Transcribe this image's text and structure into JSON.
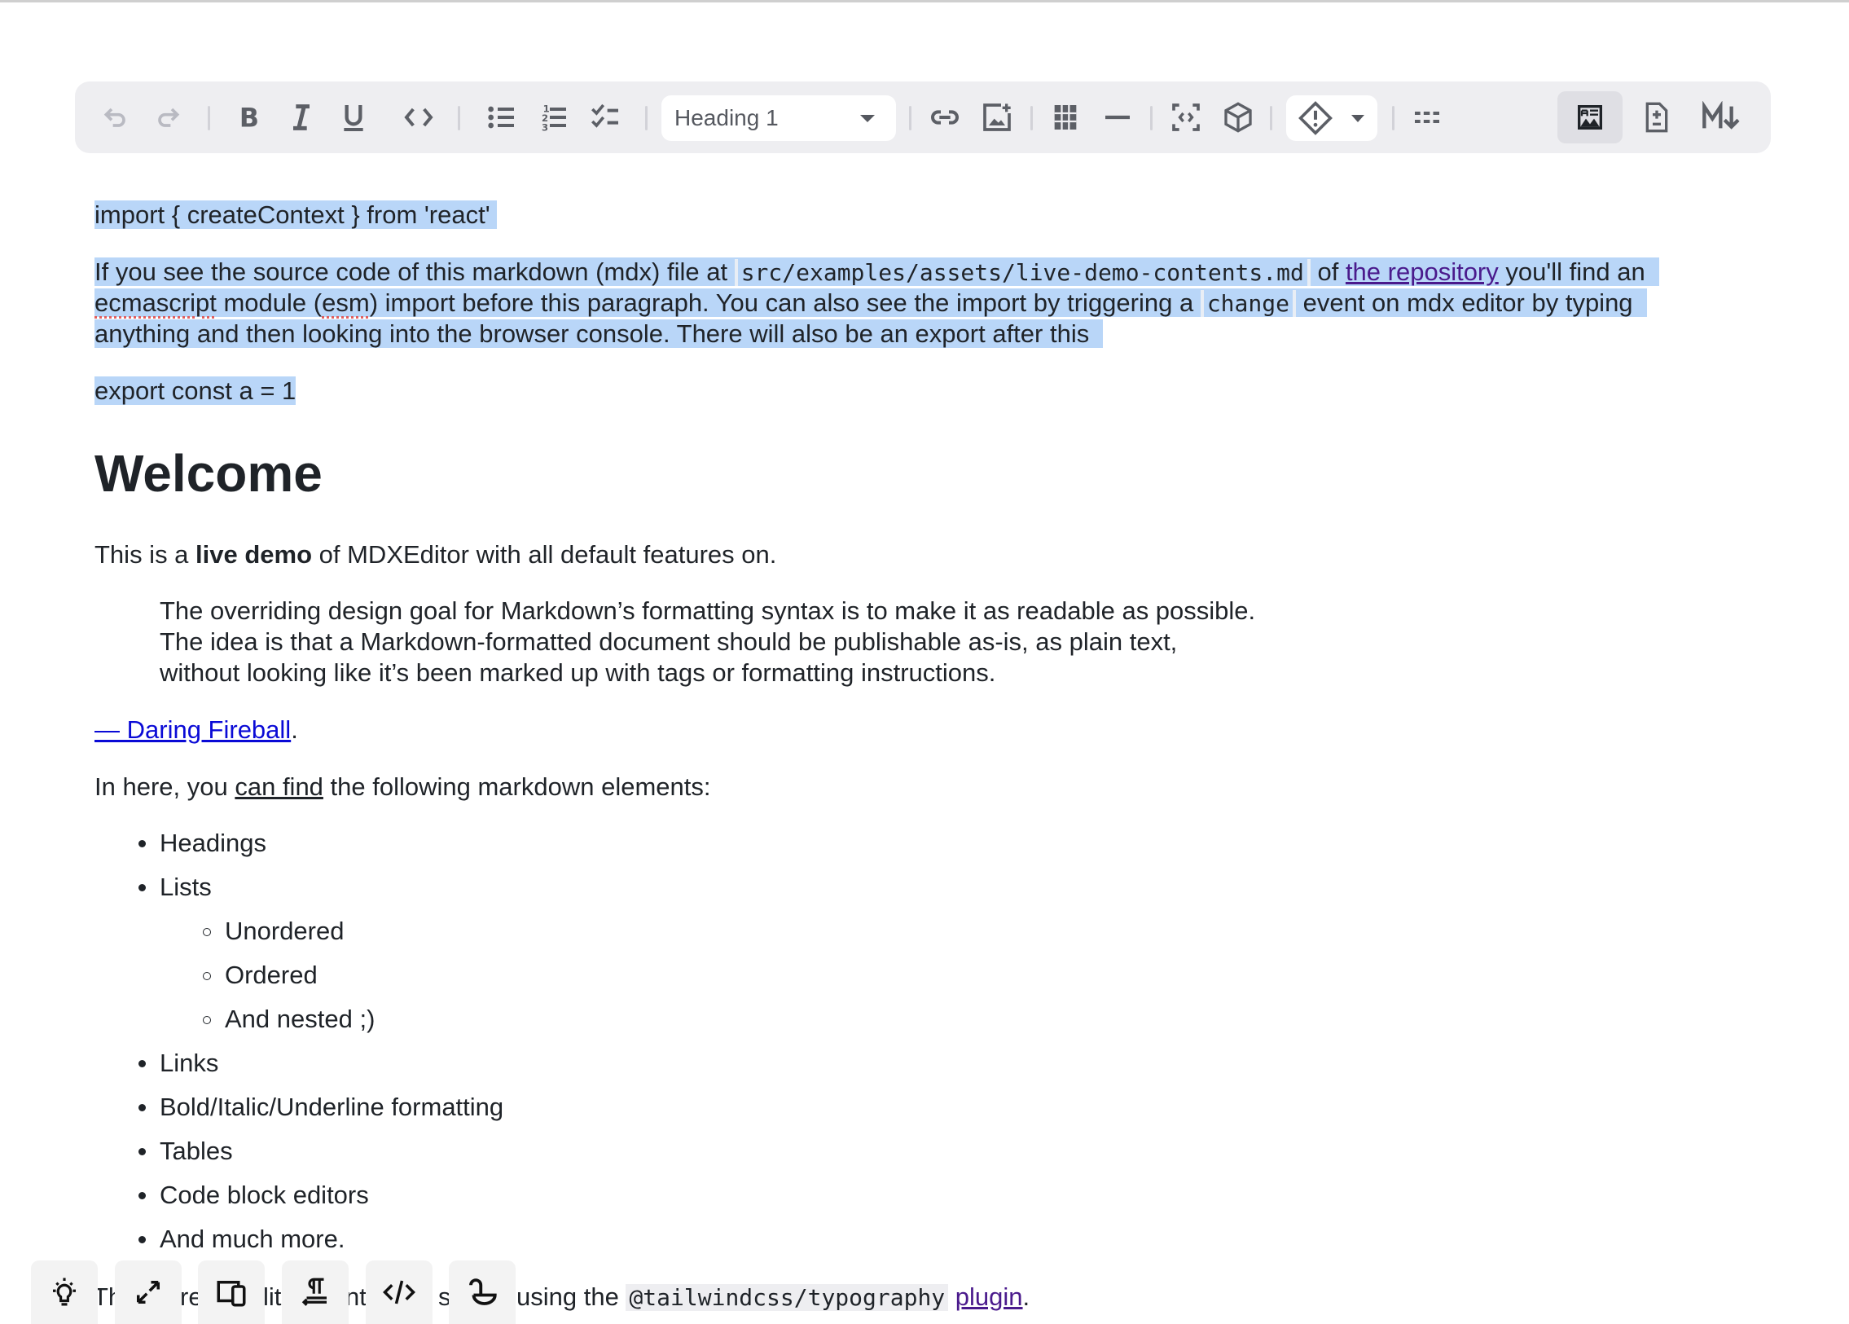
{
  "toolbar": {
    "undo": {
      "icon": "undo-icon",
      "enabled": false
    },
    "redo": {
      "icon": "redo-icon",
      "enabled": false
    },
    "formatting": [
      "bold-icon",
      "italic-icon",
      "underline-icon",
      "inline-code-icon"
    ],
    "lists": [
      "bulleted-list-icon",
      "numbered-list-icon",
      "checklist-icon"
    ],
    "block_type": {
      "selected": "Heading 1"
    },
    "insert": [
      "link-icon",
      "insert-image-icon",
      "table-icon",
      "horizontal-rule-icon",
      "code-block-icon",
      "sandpack-box-icon"
    ],
    "admonition": {
      "icon": "admonition-warning-icon"
    },
    "frontmatter": {
      "icon": "frontmatter-icon"
    },
    "view_modes": [
      {
        "name": "rich-text",
        "icon": "rich-text-icon",
        "active": true
      },
      {
        "name": "diff",
        "icon": "diff-icon",
        "active": false
      },
      {
        "name": "source",
        "icon": "markdown-icon",
        "active": false
      }
    ]
  },
  "content": {
    "esm_import": "import { createContext } from 'react'",
    "intro": {
      "p1": "If you see the source code of this markdown (mdx) file at ",
      "code1": "src/examples/assets/live-demo-contents.md",
      "p2": " of ",
      "link": "the repository",
      "p3": " you'll find an",
      "line2a": "ecmascript",
      "line2b": " module (",
      "line2c": "esm",
      "line2d": ") import before this paragraph. You can also see the import by triggering a ",
      "code2": "change",
      "line2e": " event on mdx editor by typing",
      "line3": "anything and then looking into the browser console. There will also be an export after this"
    },
    "esm_export": "export const a = 1",
    "heading": "Welcome",
    "demo_line": {
      "pre": "This is a ",
      "bold": "live demo",
      "post": " of MDXEditor with all default features on."
    },
    "quote": [
      "The overriding design goal for Markdown’s formatting syntax is to make it as readable as possible.",
      "The idea is that a Markdown-formatted document should be publishable as-is, as plain text,",
      "without looking like it’s been marked up with tags or formatting instructions."
    ],
    "attribution": {
      "link": "— Daring Fireball",
      "post": "."
    },
    "list_intro": {
      "pre": "In here, you ",
      "underlined": "can find",
      "post": " the following markdown elements:"
    },
    "list": {
      "items": [
        "Headings",
        "Lists",
        "Unordered",
        "Ordered",
        "And nested ;)",
        "Links",
        "Bold/Italic/Underline formatting",
        "Tables",
        "Code block editors",
        "And much more."
      ]
    },
    "last_line": {
      "fragments": [
        "Th",
        "re",
        "lit",
        "nt",
        "s"
      ],
      "pre": "using the ",
      "code": "@tailwindcss/typography",
      "link": "plugin",
      "post": "."
    }
  },
  "floating_buttons": [
    "lightbulb-icon",
    "expand-icon",
    "devices-icon",
    "paragraph-return-icon",
    "code-icon",
    "hook-icon"
  ]
}
